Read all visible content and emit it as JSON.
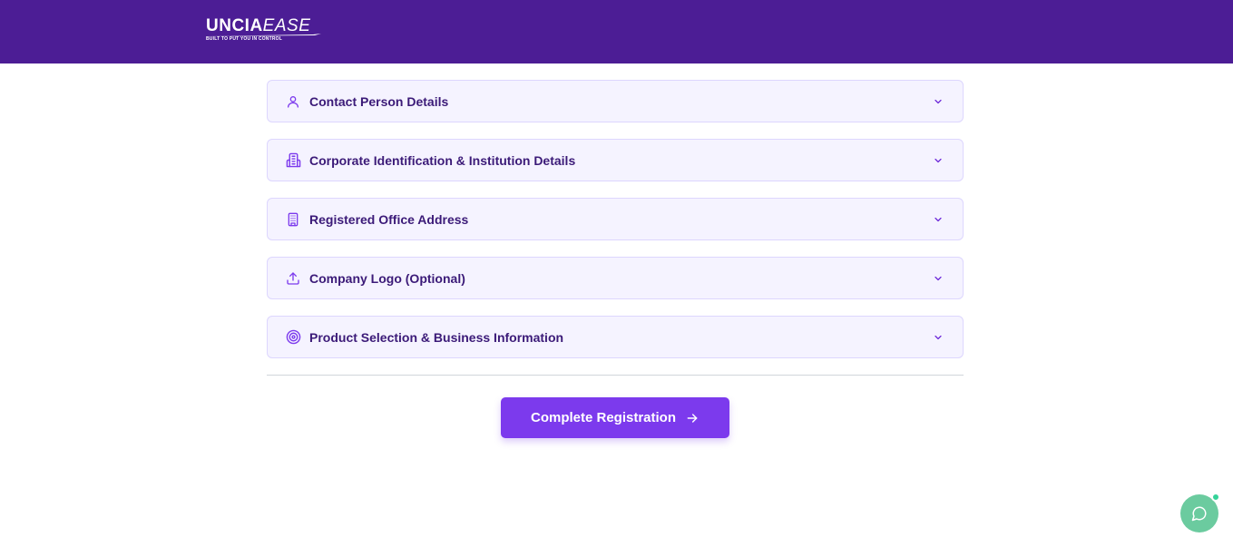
{
  "brand": {
    "name_primary": "UNCIA",
    "name_secondary": "EASE",
    "tagline": "BUILT TO PUT YOU IN CONTROL"
  },
  "sections": [
    {
      "label": "Contact Person Details",
      "icon": "user-icon"
    },
    {
      "label": "Corporate Identification & Institution Details",
      "icon": "building-certificate-icon"
    },
    {
      "label": "Registered Office Address",
      "icon": "office-building-icon"
    },
    {
      "label": "Company Logo (Optional)",
      "icon": "upload-icon"
    },
    {
      "label": "Product Selection & Business Information",
      "icon": "target-icon"
    }
  ],
  "actions": {
    "complete_label": "Complete Registration"
  },
  "colors": {
    "header_bg": "#4c1d95",
    "accent": "#7c3aed",
    "section_bg": "#f5f3ff",
    "section_border": "#ddd6fe",
    "chat_bg": "#6bcb9f"
  }
}
